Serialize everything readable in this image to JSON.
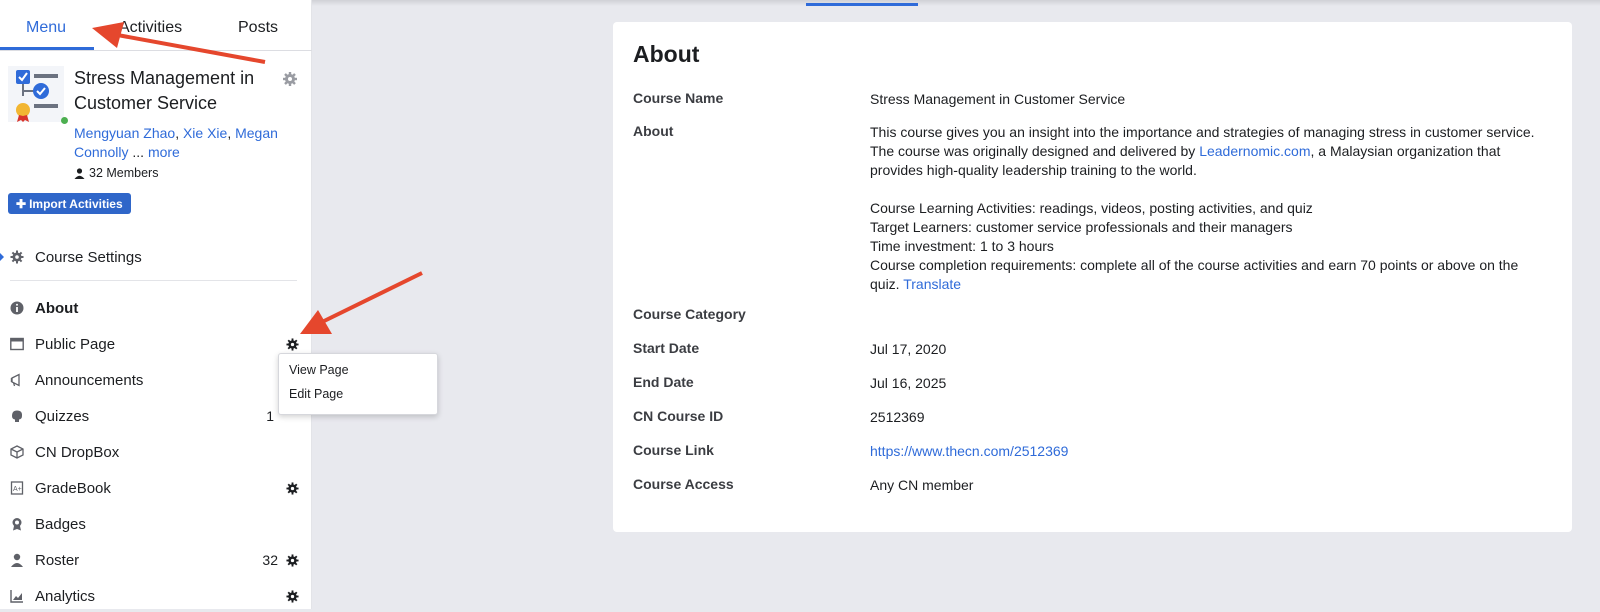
{
  "tabs": [
    {
      "label": "Menu"
    },
    {
      "label": "Activities"
    },
    {
      "label": "Posts"
    }
  ],
  "course": {
    "title": "Stress Management in Customer Service",
    "instructors": [
      "Mengyuan Zhao",
      "Xie Xie",
      "Megan Connolly"
    ],
    "instructors_more": "more",
    "ellipsis": "...",
    "members": "32 Members",
    "import_label": "Import Activities"
  },
  "nav": {
    "course_settings": "Course Settings",
    "items": [
      {
        "label": "About",
        "icon": "info-icon"
      },
      {
        "label": "Public Page",
        "icon": "window-icon"
      },
      {
        "label": "Announcements",
        "icon": "megaphone-icon"
      },
      {
        "label": "Quizzes",
        "icon": "brain-icon",
        "count": "1"
      },
      {
        "label": "CN DropBox",
        "icon": "dropbox-icon"
      },
      {
        "label": "GradeBook",
        "icon": "gradebook-icon"
      },
      {
        "label": "Badges",
        "icon": "badge-icon"
      },
      {
        "label": "Roster",
        "icon": "user-icon",
        "count": "32"
      },
      {
        "label": "Analytics",
        "icon": "chart-icon"
      }
    ]
  },
  "dropdown": {
    "view": "View Page",
    "edit": "Edit Page"
  },
  "about": {
    "title": "About",
    "course_name_label": "Course Name",
    "course_name": "Stress Management in Customer Service",
    "about_label": "About",
    "about_p1_a": "This course gives you an insight into the importance and strategies of managing stress in customer service. The course was originally designed and delivered by ",
    "about_p1_link": "Leadernomic.com",
    "about_p1_b": ", a Malaysian organization that provides high-quality leadership training to the world.",
    "about_line1": "Course Learning Activities: readings, videos, posting activities, and quiz",
    "about_line2": "Target Learners: customer service professionals and their managers",
    "about_line3": "Time investment: 1 to 3 hours",
    "about_line4": "Course completion requirements: complete all of the course activities and earn 70 points or above on the quiz.",
    "translate": "Translate",
    "category_label": "Course Category",
    "start_label": "Start Date",
    "start": "Jul 17, 2020",
    "end_label": "End Date",
    "end": "Jul 16, 2025",
    "id_label": "CN Course ID",
    "id": "2512369",
    "link_label": "Course Link",
    "link": "https://www.thecn.com/2512369",
    "access_label": "Course Access",
    "access": "Any CN member"
  },
  "colors": {
    "accent": "#2f6bd9",
    "annotation_arrow": "#e5472d"
  }
}
